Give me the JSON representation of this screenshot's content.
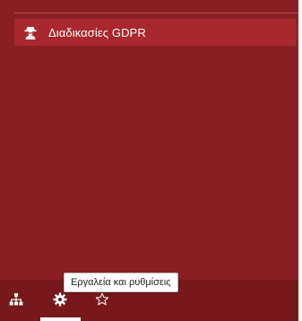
{
  "menu": {
    "items": [
      {
        "label": "Διαδικασίες GDPR",
        "icon": "detective-icon"
      }
    ]
  },
  "bottom_bar": {
    "buttons": [
      {
        "icon": "sitemap-icon"
      },
      {
        "icon": "gear-icon",
        "active": true
      },
      {
        "icon": "star-icon"
      }
    ],
    "tooltip": "Εργαλεία και ρυθμίσεις"
  },
  "colors": {
    "panel_bg": "#8b1e22",
    "item_bg": "#a9282d",
    "bottom_bar_bg": "#76181c",
    "text": "#ffffff"
  }
}
